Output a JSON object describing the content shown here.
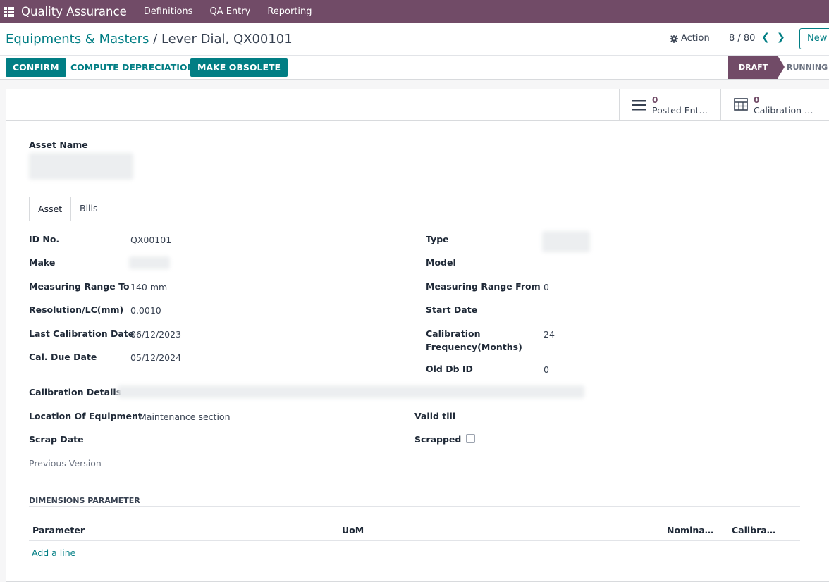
{
  "topbar": {
    "app_name": "Quality Assurance",
    "menus": [
      "Definitions",
      "QA Entry",
      "Reporting"
    ]
  },
  "breadcrumb": {
    "parent": "Equipments & Masters",
    "separator": "/",
    "current": "Lever Dial, QX00101"
  },
  "control_panel": {
    "action_label": "Action",
    "pager": "8 / 80",
    "new_label": "New"
  },
  "buttons": {
    "confirm": "CONFIRM",
    "compute_depreciation": "COMPUTE DEPRECIATION",
    "make_obsolete": "MAKE OBSOLETE"
  },
  "statusbar": {
    "stages": [
      "DRAFT",
      "RUNNING"
    ],
    "active": "DRAFT"
  },
  "smart_buttons": [
    {
      "count": "0",
      "label": "Posted Ent…",
      "icon": "list-icon"
    },
    {
      "count": "0",
      "label": "Calibration …",
      "icon": "table-icon"
    }
  ],
  "form": {
    "asset_name_label": "Asset Name",
    "tabs": [
      "Asset",
      "Bills"
    ],
    "left": [
      {
        "label": "ID No.",
        "value": "QX00101"
      },
      {
        "label": "Make",
        "value": ""
      },
      {
        "label": "Measuring Range To",
        "value": "140 mm"
      },
      {
        "label": "Resolution/LC(mm)",
        "value": "0.0010"
      },
      {
        "label": "Last Calibration Date",
        "value": "06/12/2023"
      },
      {
        "label": "Cal. Due Date",
        "value": "05/12/2024"
      }
    ],
    "right": [
      {
        "label": "Type",
        "value": ""
      },
      {
        "label": "Model",
        "value": ""
      },
      {
        "label": "Measuring Range From",
        "value": "0"
      },
      {
        "label": "Start Date",
        "value": ""
      },
      {
        "label": "Calibration Frequency(Months)",
        "label_line1": "Calibration",
        "label_line2": "Frequency(Months)",
        "value": "24"
      },
      {
        "label": "Old Db ID",
        "value": "0"
      }
    ],
    "calibration_details_label": "Calibration Details",
    "location_label": "Location Of Equipment",
    "location_value": "Maintenance section",
    "valid_till_label": "Valid till",
    "scrap_date_label": "Scrap Date",
    "scrapped_label": "Scrapped",
    "scrapped_checked": false,
    "previous_version_label": "Previous Version"
  },
  "dimensions": {
    "title": "DIMENSIONS PARAMETER",
    "columns": [
      "Parameter",
      "UoM",
      "Nomina…",
      "Calibra…"
    ],
    "add_line": "Add a line"
  }
}
